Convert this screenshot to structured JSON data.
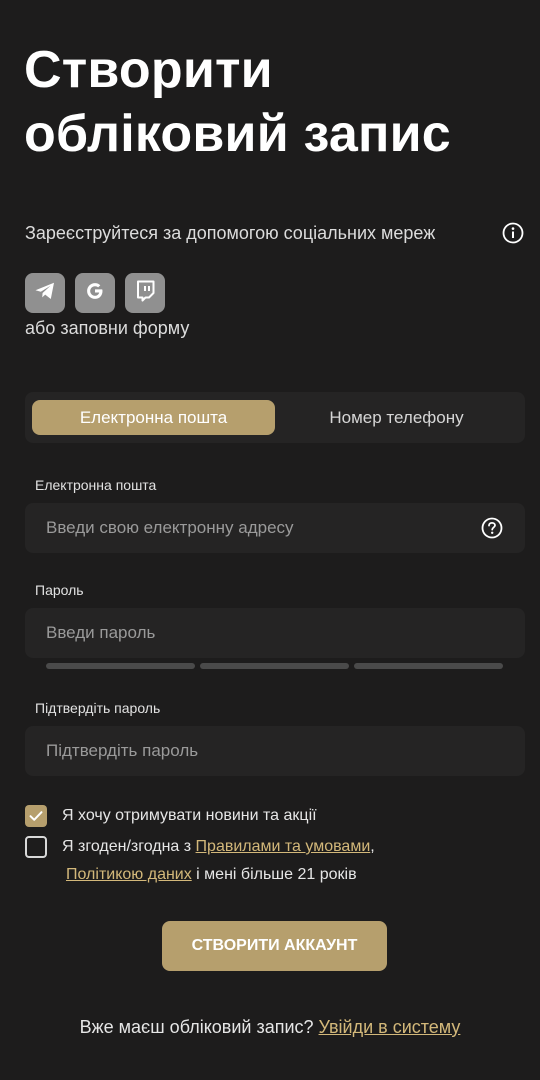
{
  "title": {
    "line1": "Створити",
    "line2": "обліковий запис"
  },
  "social": {
    "text": "Зареєструйтеся за допомогою соціальних мереж",
    "buttons": [
      "telegram-icon",
      "google-icon",
      "twitch-icon"
    ],
    "or_text": "або заповни форму"
  },
  "tabs": [
    {
      "label": "Електронна пошта",
      "active": true
    },
    {
      "label": "Номер телефону",
      "active": false
    }
  ],
  "form": {
    "email": {
      "label": "Електронна пошта",
      "placeholder": "Введи свою електронну адресу"
    },
    "password": {
      "label": "Пароль",
      "placeholder": "Введи пароль"
    },
    "confirm": {
      "label": "Підтвердіть пароль",
      "placeholder": "Підтвердіть пароль"
    }
  },
  "checks": {
    "news": {
      "label": "Я хочу отримувати новини та акції",
      "checked": true
    },
    "agree": {
      "prefix": "Я згоден/згодна з ",
      "terms_link": "Правилами та умовами",
      "comma": ",",
      "policy_link": "Політикою даних",
      "suffix": " і мені більше 21 років",
      "checked": false
    }
  },
  "submit_label": "СТВОРИТИ АККАУНТ",
  "login": {
    "text": "Вже маєш обліковий запис? ",
    "link": "Увійди в систему"
  },
  "colors": {
    "accent": "#b69f6d",
    "link": "#d3b87a",
    "background": "#1d1c1c",
    "field": "#252424"
  }
}
